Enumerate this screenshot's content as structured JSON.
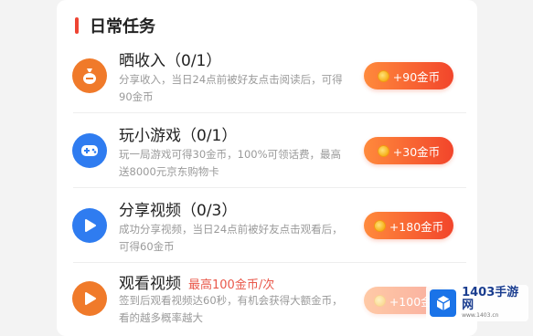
{
  "section": {
    "title": "日常任务"
  },
  "tasks": [
    {
      "icon": "money-bag-icon",
      "title": "晒收入",
      "progress": "（0/1）",
      "hint": "",
      "desc": "分享收入，当日24点前被好友点击阅读后，可得90金币",
      "reward": "+90金币"
    },
    {
      "icon": "gamepad-icon",
      "title": "玩小游戏",
      "progress": "（0/1）",
      "hint": "",
      "desc": "玩一局游戏可得30金币，100%可领话费，最高送8000元京东购物卡",
      "reward": "+30金币"
    },
    {
      "icon": "play-video-icon",
      "title": "分享视频",
      "progress": "（0/3）",
      "hint": "",
      "desc": "成功分享视频，当日24点前被好友点击观看后，可得60金币",
      "reward": "+180金币"
    },
    {
      "icon": "play-video-icon",
      "title": "观看视频",
      "progress": "",
      "hint": "最高100金币/次",
      "desc": "签到后观看视频达60秒，有机会获得大额金币，看的越多概率越大",
      "reward": "+100金币"
    }
  ],
  "watermark": {
    "name": "1403手游网",
    "url": "www.1403.cn"
  },
  "colors": {
    "accent": "#ee4433",
    "icon_orange": "#f07a2a",
    "icon_blue": "#2f7cf0"
  }
}
